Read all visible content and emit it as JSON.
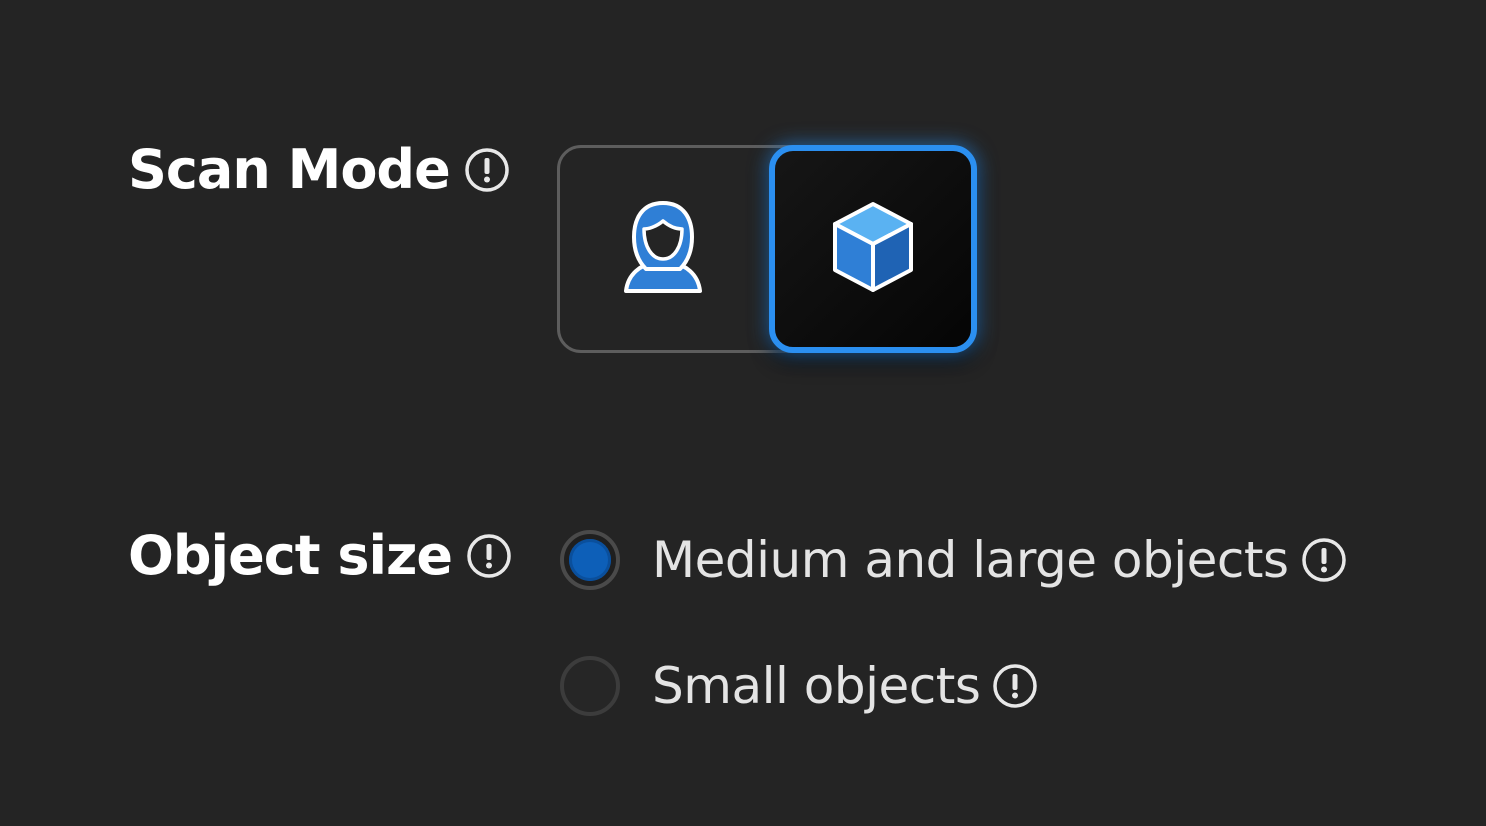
{
  "scan_mode": {
    "label": "Scan Mode",
    "info_icon": "info-exclamation-icon",
    "options": [
      {
        "id": "portrait",
        "icon": "person-icon",
        "selected": false
      },
      {
        "id": "object",
        "icon": "cube-icon",
        "selected": true
      }
    ]
  },
  "object_size": {
    "label": "Object size",
    "info_icon": "info-exclamation-icon",
    "options": [
      {
        "label": "Medium and large objects",
        "selected": true
      },
      {
        "label": "Small objects",
        "selected": false
      }
    ]
  },
  "colors": {
    "background": "#242424",
    "accent": "#2b8ff0",
    "radio_fill": "#0d5fb8",
    "text": "#ffffff"
  }
}
